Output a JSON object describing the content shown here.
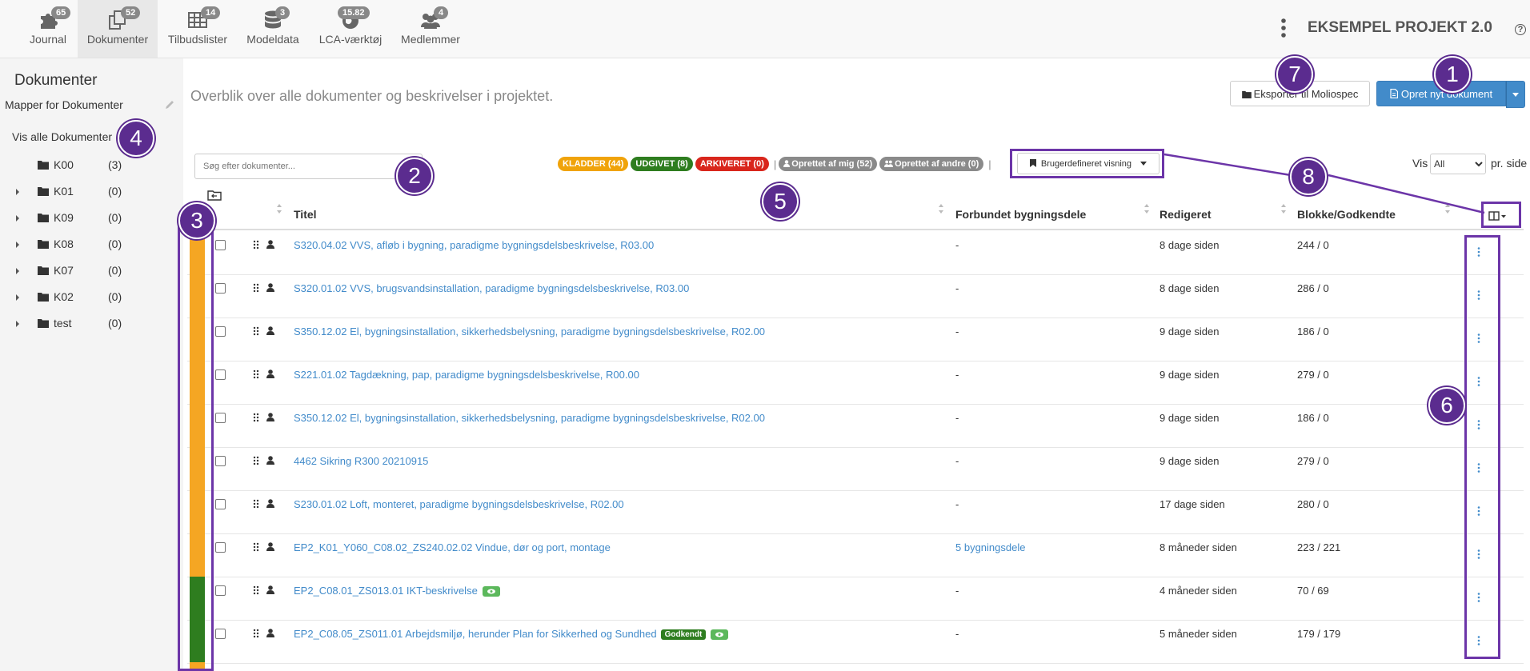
{
  "nav": {
    "tabs": [
      {
        "label": "Journal",
        "badge": "65",
        "icon": "puzzle-icon"
      },
      {
        "label": "Dokumenter",
        "badge": "52",
        "icon": "documents-icon"
      },
      {
        "label": "Tilbudslister",
        "badge": "14",
        "icon": "table-icon"
      },
      {
        "label": "Modeldata",
        "badge": "3",
        "icon": "database-icon"
      },
      {
        "label": "LCA-værktøj",
        "badge": "15.82",
        "icon": "globe-icon"
      },
      {
        "label": "Medlemmer",
        "badge": "4",
        "icon": "users-icon"
      }
    ],
    "project_title": "EKSEMPEL PROJEKT 2.0",
    "help": "?"
  },
  "sidebar": {
    "title": "Dokumenter",
    "subtitle": "Mapper for Dokumenter",
    "show_all": "Vis alle Dokumenter",
    "folders": [
      {
        "name": "K00",
        "count": "(3)"
      },
      {
        "name": "K01",
        "count": "(0)"
      },
      {
        "name": "K09",
        "count": "(0)"
      },
      {
        "name": "K08",
        "count": "(0)"
      },
      {
        "name": "K07",
        "count": "(0)"
      },
      {
        "name": "K02",
        "count": "(0)"
      },
      {
        "name": "test",
        "count": "(0)"
      }
    ]
  },
  "main": {
    "intro": "Overblik over alle dokumenter og beskrivelser i projektet.",
    "export_button": "Eksporter til Moliospec",
    "create_button": "Opret nyt dokument",
    "search_placeholder": "Søg efter dokumenter...",
    "filters": [
      {
        "label": "KLADDER (44)",
        "color": "#f0a30a"
      },
      {
        "label": "UDGIVET (8)",
        "color": "#2e7d1f"
      },
      {
        "label": "ARKIVERET (0)",
        "color": "#d9261c"
      },
      {
        "label": "Oprettet af mig (52)",
        "color": "#8a8a8a"
      },
      {
        "label": "Oprettet af andre (0)",
        "color": "#8a8a8a"
      }
    ],
    "view_button": "Brugerdefineret visning",
    "show_label": "Vis",
    "per_page_value": "All",
    "per_page_suffix": "pr. side",
    "columns": {
      "title": "Titel",
      "connected": "Forbundet bygningsdele",
      "edited": "Redigeret",
      "blocks": "Blokke/Godkendte"
    },
    "rows": [
      {
        "title": "S320.04.02 VVS, afløb i bygning, paradigme bygningsdelsbeskrivelse, R03.00",
        "connected": "-",
        "edited": "8 dage siden",
        "blocks": "244 / 0",
        "status_color": "#f5a623"
      },
      {
        "title": "S320.01.02 VVS, brugsvandsinstallation, paradigme bygningsdelsbeskrivelse, R03.00",
        "connected": "-",
        "edited": "8 dage siden",
        "blocks": "286 / 0",
        "status_color": "#f5a623"
      },
      {
        "title": "S350.12.02 El, bygningsinstallation, sikkerhedsbelysning, paradigme bygningsdelsbeskrivelse, R02.00",
        "connected": "-",
        "edited": "9 dage siden",
        "blocks": "186 / 0",
        "status_color": "#f5a623"
      },
      {
        "title": "S221.01.02 Tagdækning, pap, paradigme bygningsdelsbeskrivelse, R00.00",
        "connected": "-",
        "edited": "9 dage siden",
        "blocks": "279 / 0",
        "status_color": "#f5a623"
      },
      {
        "title": "S350.12.02 El, bygningsinstallation, sikkerhedsbelysning, paradigme bygningsdelsbeskrivelse, R02.00",
        "connected": "-",
        "edited": "9 dage siden",
        "blocks": "186 / 0",
        "status_color": "#f5a623"
      },
      {
        "title": "4462 Sikring R300 20210915",
        "connected": "-",
        "edited": "9 dage siden",
        "blocks": "279 / 0",
        "status_color": "#f5a623"
      },
      {
        "title": "S230.01.02 Loft, monteret, paradigme bygningsdelsbeskrivelse, R02.00",
        "connected": "-",
        "edited": "17 dage siden",
        "blocks": "280 / 0",
        "status_color": "#f5a623"
      },
      {
        "title": "EP2_K01_Y060_C08.02_ZS240.02.02 Vindue, dør og port, montage",
        "connected": "5 bygningsdele",
        "edited": "8 måneder siden",
        "blocks": "223 / 221",
        "status_color": "#f5a623"
      },
      {
        "title": "EP2_C08.01_ZS013.01 IKT-beskrivelse",
        "connected": "-",
        "edited": "4 måneder siden",
        "blocks": "70 / 69",
        "status_color": "#2e7d1f"
      },
      {
        "title": "EP2_C08.05_ZS011.01 Arbejdsmiljø, herunder Plan for Sikkerhed og Sundhed",
        "connected": "-",
        "edited": "5 måneder siden",
        "blocks": "179 / 179",
        "status_color": "#2e7d1f",
        "approved_tag": "Godkendt"
      }
    ]
  },
  "annotations": [
    "1",
    "2",
    "3",
    "4",
    "5",
    "6",
    "7",
    "8"
  ],
  "colors": {
    "accent": "#428bca",
    "annotation": "#5b2c8f"
  }
}
